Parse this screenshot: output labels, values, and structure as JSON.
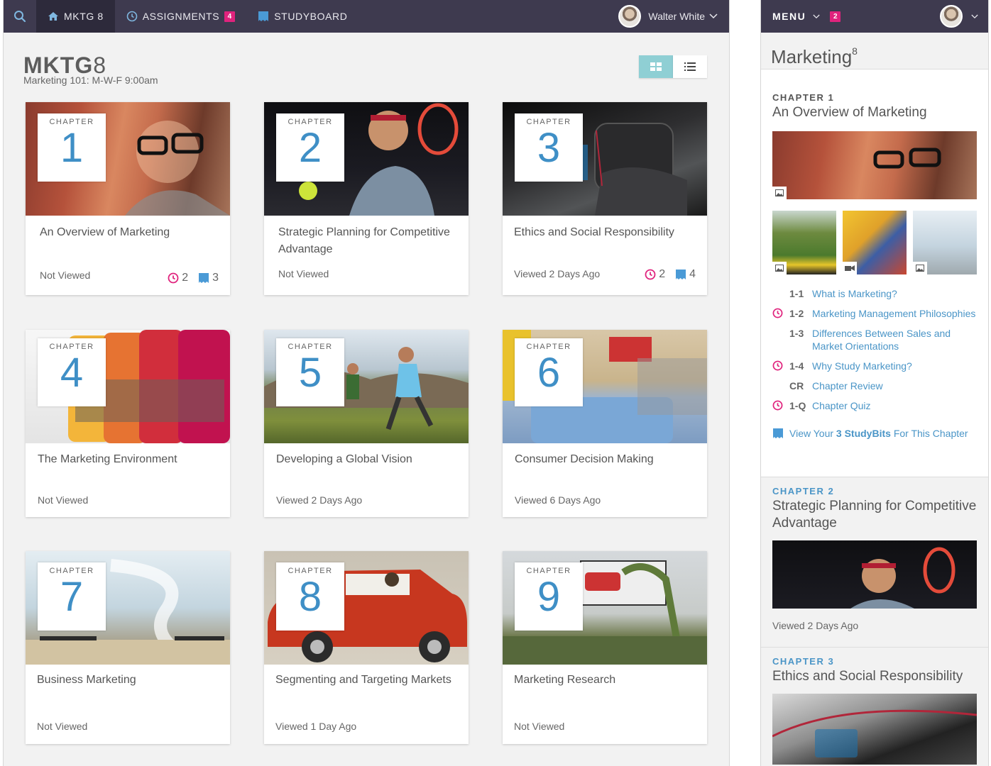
{
  "nav": {
    "course_tab": "MKTG 8",
    "assignments_label": "ASSIGNMENTS",
    "assignments_badge": "4",
    "studyboard_label": "STUDYBOARD",
    "user_name": "Walter White"
  },
  "course": {
    "title_bold": "MKTG",
    "title_num": "8",
    "subtitle": "Marketing 101: M-W-F 9:00am"
  },
  "chapter_label": "CHAPTER",
  "cards": [
    {
      "num": "1",
      "title": "An Overview of Marketing",
      "status": "Not Viewed",
      "assignments": "2",
      "studybits": "3"
    },
    {
      "num": "2",
      "title": "Strategic Planning for Competitive Advantage",
      "status": "Not Viewed"
    },
    {
      "num": "3",
      "title": "Ethics and Social Responsibility",
      "status": "Viewed 2 Days Ago",
      "assignments": "2",
      "studybits": "4"
    },
    {
      "num": "4",
      "title": "The Marketing Environment",
      "status": "Not Viewed"
    },
    {
      "num": "5",
      "title": "Developing a Global Vision",
      "status": "Viewed 2 Days Ago"
    },
    {
      "num": "6",
      "title": "Consumer Decision Making",
      "status": "Viewed 6 Days Ago"
    },
    {
      "num": "7",
      "title": "Business Marketing",
      "status": "Not Viewed"
    },
    {
      "num": "8",
      "title": "Segmenting and Targeting Markets",
      "status": "Viewed 1 Day Ago"
    },
    {
      "num": "9",
      "title": "Marketing Research",
      "status": "Not Viewed"
    }
  ],
  "panel": {
    "menu_label": "MENU",
    "menu_badge": "2",
    "title": "Marketing",
    "title_sup": "8",
    "ch1": {
      "label": "CHAPTER 1",
      "title": "An Overview of Marketing",
      "toc": [
        {
          "num": "1-1",
          "text": "What is Marketing?",
          "assignment": false
        },
        {
          "num": "1-2",
          "text": "Marketing Management Philosophies",
          "assignment": true
        },
        {
          "num": "1-3",
          "text": "Differences Between Sales and Market Orientations",
          "assignment": false
        },
        {
          "num": "1-4",
          "text": "Why Study Marketing?",
          "assignment": true
        },
        {
          "num": "CR",
          "text": "Chapter Review",
          "assignment": false
        },
        {
          "num": "1-Q",
          "text": "Chapter Quiz",
          "assignment": true
        }
      ],
      "studybits_pre": "View Your ",
      "studybits_bold": "3 StudyBits",
      "studybits_post": " For This Chapter"
    },
    "ch2": {
      "label": "CHAPTER 2",
      "title": "Strategic Planning for Competitive Advantage",
      "status": "Viewed 2 Days Ago"
    },
    "ch3": {
      "label": "CHAPTER 3",
      "title": "Ethics and Social Responsibility"
    }
  },
  "colors": {
    "nav_bg": "#3e3a4f",
    "accent_pink": "#e0237d",
    "link_blue": "#4a95c7",
    "toggle_on": "#8fcfd4"
  }
}
